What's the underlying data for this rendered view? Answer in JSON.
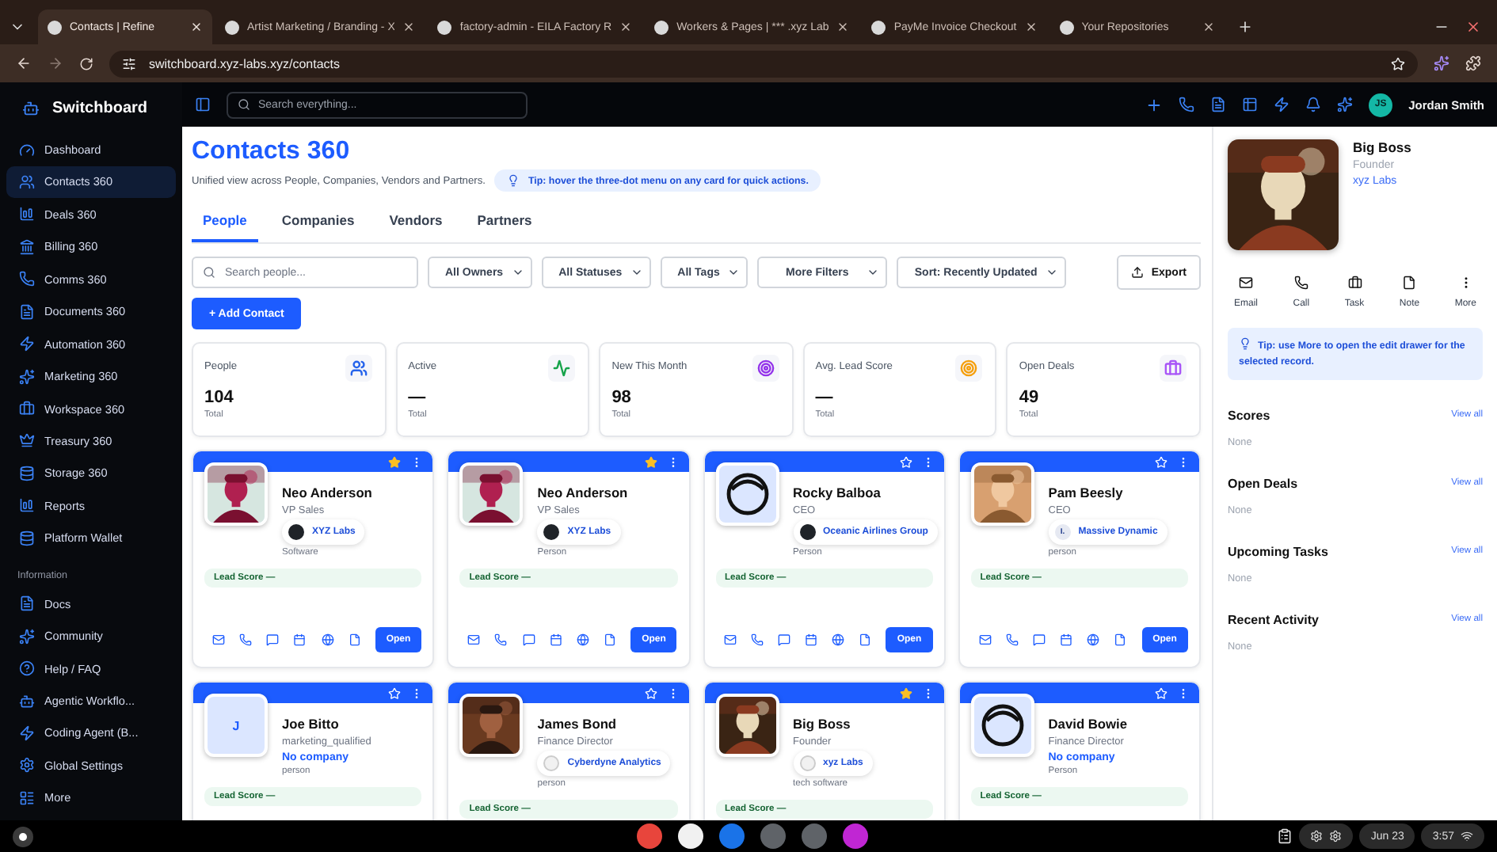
{
  "browser": {
    "tabs": [
      {
        "title": "Contacts | Refine",
        "selected": true
      },
      {
        "title": "Artist Marketing / Branding - X",
        "selected": false
      },
      {
        "title": "factory-admin - EILA Factory R",
        "selected": false
      },
      {
        "title": "Workers & Pages | *** .xyz Lab",
        "selected": false
      },
      {
        "title": "PayMe Invoice Checkout",
        "selected": false
      },
      {
        "title": "Your Repositories",
        "selected": false
      }
    ],
    "url": "switchboard.xyz-labs.xyz/contacts"
  },
  "sidebar": {
    "brand": "Switchboard",
    "items": [
      {
        "label": "Dashboard",
        "selected": false
      },
      {
        "label": "Contacts 360",
        "selected": true
      },
      {
        "label": "Deals 360",
        "selected": false
      },
      {
        "label": "Billing 360",
        "selected": false
      },
      {
        "label": "Comms 360",
        "selected": false
      },
      {
        "label": "Documents 360",
        "selected": false
      },
      {
        "label": "Automation 360",
        "selected": false
      },
      {
        "label": "Marketing 360",
        "selected": false
      },
      {
        "label": "Workspace 360",
        "selected": false
      },
      {
        "label": "Treasury 360",
        "selected": false
      },
      {
        "label": "Storage 360",
        "selected": false
      },
      {
        "label": "Reports",
        "selected": false
      },
      {
        "label": "Platform Wallet",
        "selected": false
      }
    ],
    "section_label": "Information",
    "info_items": [
      {
        "label": "Docs"
      },
      {
        "label": "Community"
      },
      {
        "label": "Help / FAQ"
      },
      {
        "label": "Agentic Workflo..."
      },
      {
        "label": "Coding Agent (B..."
      },
      {
        "label": "Global Settings"
      },
      {
        "label": "More"
      }
    ]
  },
  "topbar": {
    "search_placeholder": "Search everything...",
    "user": {
      "initials": "JS",
      "name": "Jordan Smith"
    }
  },
  "page": {
    "title": "Contacts 360",
    "subtitle": "Unified view across People, Companies, Vendors and Partners.",
    "tip": "Tip: hover the three-dot menu on any card for quick actions.",
    "tabs": [
      {
        "label": "People",
        "selected": true
      },
      {
        "label": "Companies",
        "selected": false
      },
      {
        "label": "Vendors",
        "selected": false
      },
      {
        "label": "Partners",
        "selected": false
      }
    ],
    "search_placeholder": "Search people...",
    "filters": [
      "All Owners",
      "All Statuses",
      "All Tags",
      "More Filters",
      "Sort: Recently Updated"
    ],
    "export": "Export",
    "add_button": "+ Add Contact"
  },
  "stats": [
    {
      "label": "People",
      "value": "104",
      "sub": "Total",
      "color": "#2563eb"
    },
    {
      "label": "Active",
      "value": "—",
      "sub": "Total",
      "color": "#16a34a"
    },
    {
      "label": "New This Month",
      "value": "98",
      "sub": "Total",
      "color": "#9333ea"
    },
    {
      "label": "Avg. Lead Score",
      "value": "—",
      "sub": "Total",
      "color": "#f59e0b"
    },
    {
      "label": "Open Deals",
      "value": "49",
      "sub": "Total",
      "color": "#a855f7"
    }
  ],
  "contacts": [
    {
      "name": "Neo Anderson",
      "title": "VP Sales",
      "company": {
        "name": "XYZ Labs",
        "kind": "dark"
      },
      "type": "Software",
      "favorite": true,
      "lead_score": "Lead Score —",
      "action": "Open"
    },
    {
      "name": "Neo Anderson",
      "title": "VP Sales",
      "company": {
        "name": "XYZ Labs",
        "kind": "dark"
      },
      "type": "Person",
      "favorite": true,
      "lead_score": "Lead Score —",
      "action": "Open"
    },
    {
      "name": "Rocky Balboa",
      "title": "CEO",
      "avatar": {
        "kind": "icon"
      },
      "company": {
        "name": "Oceanic Airlines Group",
        "kind": "dark"
      },
      "type": "Person",
      "favorite": false,
      "lead_score": "Lead Score —",
      "action": "Open"
    },
    {
      "name": "Pam Beesly",
      "title": "CEO",
      "company": {
        "name": "Massive Dynamic",
        "kind": "letter",
        "logo_text": "I."
      },
      "type": "person",
      "favorite": false,
      "lead_score": "Lead Score —",
      "action": "Open"
    },
    {
      "name": "Joe Bitto",
      "title": "marketing_qualified",
      "avatar": {
        "kind": "initial",
        "text": "J"
      },
      "no_company": "No company",
      "type": "person",
      "favorite": false,
      "lead_score": "Lead Score —"
    },
    {
      "name": "James Bond",
      "title": "Finance Director",
      "company": {
        "name": "Cyberdyne Analytics",
        "kind": "light"
      },
      "type": "person",
      "favorite": false,
      "lead_score": "Lead Score —"
    },
    {
      "name": "Big Boss",
      "title": "Founder",
      "company": {
        "name": "xyz Labs",
        "kind": "light"
      },
      "type": "tech software",
      "favorite": true,
      "lead_score": "Lead Score —"
    },
    {
      "name": "David Bowie",
      "title": "Finance Director",
      "avatar": {
        "kind": "icon"
      },
      "no_company": "No company",
      "type": "Person",
      "favorite": false,
      "lead_score": "Lead Score —"
    }
  ],
  "detail": {
    "name": "Big Boss",
    "role": "Founder",
    "company": "xyz Labs",
    "actions": [
      "Email",
      "Call",
      "Task",
      "Note",
      "More"
    ],
    "tip": "Tip: use More to open the edit drawer for the selected record.",
    "sections": [
      {
        "title": "Scores",
        "link": "View all",
        "empty": "None"
      },
      {
        "title": "Open Deals",
        "link": "View all",
        "empty": "None"
      },
      {
        "title": "Upcoming Tasks",
        "link": "View all",
        "empty": "None"
      },
      {
        "title": "Recent Activity",
        "link": "View all",
        "empty": "None"
      }
    ]
  },
  "taskbar": {
    "date": "Jun 23",
    "time": "3:57"
  }
}
